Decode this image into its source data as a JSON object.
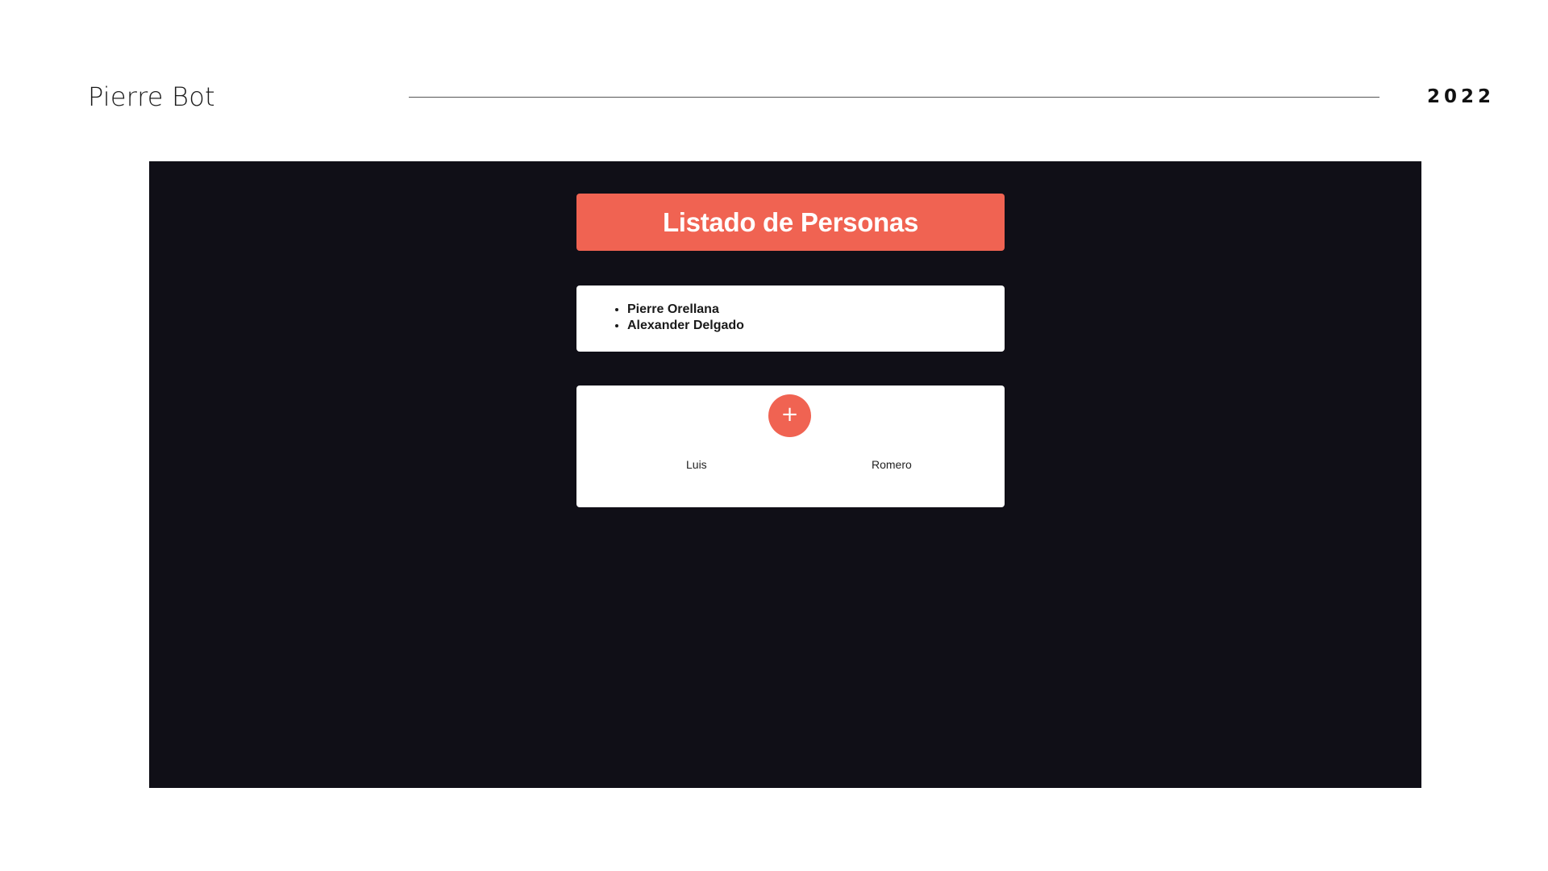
{
  "slide": {
    "author": "Pierre Bot",
    "year": "2022"
  },
  "app": {
    "title": "Listado de Personas",
    "people": [
      "Pierre Orellana",
      "Alexander Delgado"
    ],
    "add_button_label": "+",
    "form": {
      "first_name": "Luis",
      "last_name": "Romero"
    }
  },
  "colors": {
    "accent": "#f06352",
    "screen_background": "#100f17",
    "card_background": "#ffffff"
  }
}
